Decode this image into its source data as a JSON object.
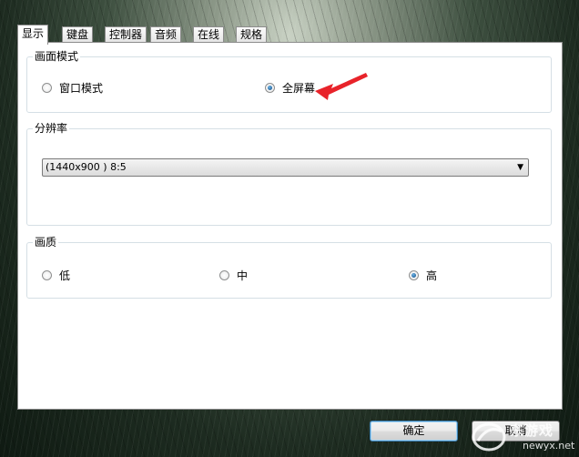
{
  "tabs": [
    {
      "label": "显示",
      "active": true
    },
    {
      "label": "键盘",
      "active": false
    },
    {
      "label": "控制器",
      "active": false
    },
    {
      "label": "音频",
      "active": false
    },
    {
      "label": "在线",
      "active": false
    },
    {
      "label": "规格",
      "active": false
    }
  ],
  "display_mode": {
    "title": "画面模式",
    "options": [
      {
        "label": "窗口模式",
        "selected": false
      },
      {
        "label": "全屏幕",
        "selected": true
      }
    ]
  },
  "resolution": {
    "title": "分辨率",
    "selected_value": "(1440x900 ) 8:5"
  },
  "quality": {
    "title": "画质",
    "options": [
      {
        "label": "低",
        "selected": false
      },
      {
        "label": "中",
        "selected": false
      },
      {
        "label": "高",
        "selected": true
      }
    ]
  },
  "buttons": {
    "ok": "确定",
    "cancel": "取消"
  },
  "annotation_color": "#e8232a",
  "watermark": {
    "brand": "东游戏",
    "site": "newyx.net"
  }
}
